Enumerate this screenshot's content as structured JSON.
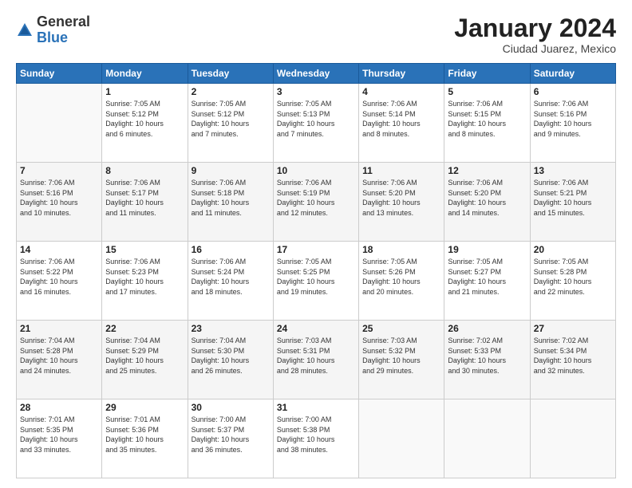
{
  "logo": {
    "general": "General",
    "blue": "Blue"
  },
  "header": {
    "month": "January 2024",
    "location": "Ciudad Juarez, Mexico"
  },
  "weekdays": [
    "Sunday",
    "Monday",
    "Tuesday",
    "Wednesday",
    "Thursday",
    "Friday",
    "Saturday"
  ],
  "weeks": [
    [
      {
        "day": "",
        "info": ""
      },
      {
        "day": "1",
        "info": "Sunrise: 7:05 AM\nSunset: 5:12 PM\nDaylight: 10 hours\nand 6 minutes."
      },
      {
        "day": "2",
        "info": "Sunrise: 7:05 AM\nSunset: 5:12 PM\nDaylight: 10 hours\nand 7 minutes."
      },
      {
        "day": "3",
        "info": "Sunrise: 7:05 AM\nSunset: 5:13 PM\nDaylight: 10 hours\nand 7 minutes."
      },
      {
        "day": "4",
        "info": "Sunrise: 7:06 AM\nSunset: 5:14 PM\nDaylight: 10 hours\nand 8 minutes."
      },
      {
        "day": "5",
        "info": "Sunrise: 7:06 AM\nSunset: 5:15 PM\nDaylight: 10 hours\nand 8 minutes."
      },
      {
        "day": "6",
        "info": "Sunrise: 7:06 AM\nSunset: 5:16 PM\nDaylight: 10 hours\nand 9 minutes."
      }
    ],
    [
      {
        "day": "7",
        "info": "Sunrise: 7:06 AM\nSunset: 5:16 PM\nDaylight: 10 hours\nand 10 minutes."
      },
      {
        "day": "8",
        "info": "Sunrise: 7:06 AM\nSunset: 5:17 PM\nDaylight: 10 hours\nand 11 minutes."
      },
      {
        "day": "9",
        "info": "Sunrise: 7:06 AM\nSunset: 5:18 PM\nDaylight: 10 hours\nand 11 minutes."
      },
      {
        "day": "10",
        "info": "Sunrise: 7:06 AM\nSunset: 5:19 PM\nDaylight: 10 hours\nand 12 minutes."
      },
      {
        "day": "11",
        "info": "Sunrise: 7:06 AM\nSunset: 5:20 PM\nDaylight: 10 hours\nand 13 minutes."
      },
      {
        "day": "12",
        "info": "Sunrise: 7:06 AM\nSunset: 5:20 PM\nDaylight: 10 hours\nand 14 minutes."
      },
      {
        "day": "13",
        "info": "Sunrise: 7:06 AM\nSunset: 5:21 PM\nDaylight: 10 hours\nand 15 minutes."
      }
    ],
    [
      {
        "day": "14",
        "info": "Sunrise: 7:06 AM\nSunset: 5:22 PM\nDaylight: 10 hours\nand 16 minutes."
      },
      {
        "day": "15",
        "info": "Sunrise: 7:06 AM\nSunset: 5:23 PM\nDaylight: 10 hours\nand 17 minutes."
      },
      {
        "day": "16",
        "info": "Sunrise: 7:06 AM\nSunset: 5:24 PM\nDaylight: 10 hours\nand 18 minutes."
      },
      {
        "day": "17",
        "info": "Sunrise: 7:05 AM\nSunset: 5:25 PM\nDaylight: 10 hours\nand 19 minutes."
      },
      {
        "day": "18",
        "info": "Sunrise: 7:05 AM\nSunset: 5:26 PM\nDaylight: 10 hours\nand 20 minutes."
      },
      {
        "day": "19",
        "info": "Sunrise: 7:05 AM\nSunset: 5:27 PM\nDaylight: 10 hours\nand 21 minutes."
      },
      {
        "day": "20",
        "info": "Sunrise: 7:05 AM\nSunset: 5:28 PM\nDaylight: 10 hours\nand 22 minutes."
      }
    ],
    [
      {
        "day": "21",
        "info": "Sunrise: 7:04 AM\nSunset: 5:28 PM\nDaylight: 10 hours\nand 24 minutes."
      },
      {
        "day": "22",
        "info": "Sunrise: 7:04 AM\nSunset: 5:29 PM\nDaylight: 10 hours\nand 25 minutes."
      },
      {
        "day": "23",
        "info": "Sunrise: 7:04 AM\nSunset: 5:30 PM\nDaylight: 10 hours\nand 26 minutes."
      },
      {
        "day": "24",
        "info": "Sunrise: 7:03 AM\nSunset: 5:31 PM\nDaylight: 10 hours\nand 28 minutes."
      },
      {
        "day": "25",
        "info": "Sunrise: 7:03 AM\nSunset: 5:32 PM\nDaylight: 10 hours\nand 29 minutes."
      },
      {
        "day": "26",
        "info": "Sunrise: 7:02 AM\nSunset: 5:33 PM\nDaylight: 10 hours\nand 30 minutes."
      },
      {
        "day": "27",
        "info": "Sunrise: 7:02 AM\nSunset: 5:34 PM\nDaylight: 10 hours\nand 32 minutes."
      }
    ],
    [
      {
        "day": "28",
        "info": "Sunrise: 7:01 AM\nSunset: 5:35 PM\nDaylight: 10 hours\nand 33 minutes."
      },
      {
        "day": "29",
        "info": "Sunrise: 7:01 AM\nSunset: 5:36 PM\nDaylight: 10 hours\nand 35 minutes."
      },
      {
        "day": "30",
        "info": "Sunrise: 7:00 AM\nSunset: 5:37 PM\nDaylight: 10 hours\nand 36 minutes."
      },
      {
        "day": "31",
        "info": "Sunrise: 7:00 AM\nSunset: 5:38 PM\nDaylight: 10 hours\nand 38 minutes."
      },
      {
        "day": "",
        "info": ""
      },
      {
        "day": "",
        "info": ""
      },
      {
        "day": "",
        "info": ""
      }
    ]
  ]
}
